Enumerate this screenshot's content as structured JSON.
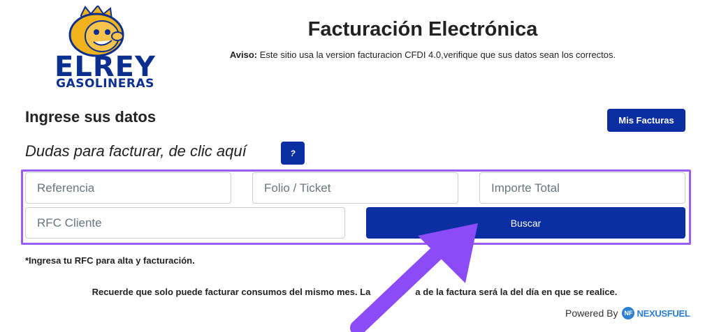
{
  "logo": {
    "line1": "ELREY",
    "line2": "GASOLINERAS"
  },
  "header": {
    "title": "Facturación Electrónica",
    "aviso_label": "Aviso:",
    "aviso_text": " Este sitio usa la version facturacion CFDI 4.0,verifique que sus datos sean los correctos."
  },
  "section": {
    "heading": "Ingrese sus datos",
    "dudas": "Dudas para facturar, de clic aquí",
    "help_label": "?",
    "mis_facturas": "Mis Facturas"
  },
  "form": {
    "referencia_placeholder": "Referencia",
    "folio_placeholder": "Folio / Ticket",
    "importe_placeholder": "Importe Total",
    "rfc_placeholder": "RFC Cliente",
    "buscar": "Buscar"
  },
  "notes": {
    "rfc_note": "*Ingresa tu RFC para alta y facturación.",
    "recuerde_before": "Recuerde que solo puede facturar consumos del mismo mes. La",
    "recuerde_after": "a de la factura será la del día en que se realice."
  },
  "footer": {
    "powered": "Powered By",
    "brand_mark": "NF",
    "brand": "NEXUSFUEL"
  },
  "colors": {
    "primary": "#0b2ea3",
    "highlight": "#9b5cf5",
    "logo_blue": "#0a2f8f",
    "logo_gold": "#f2b21c"
  }
}
